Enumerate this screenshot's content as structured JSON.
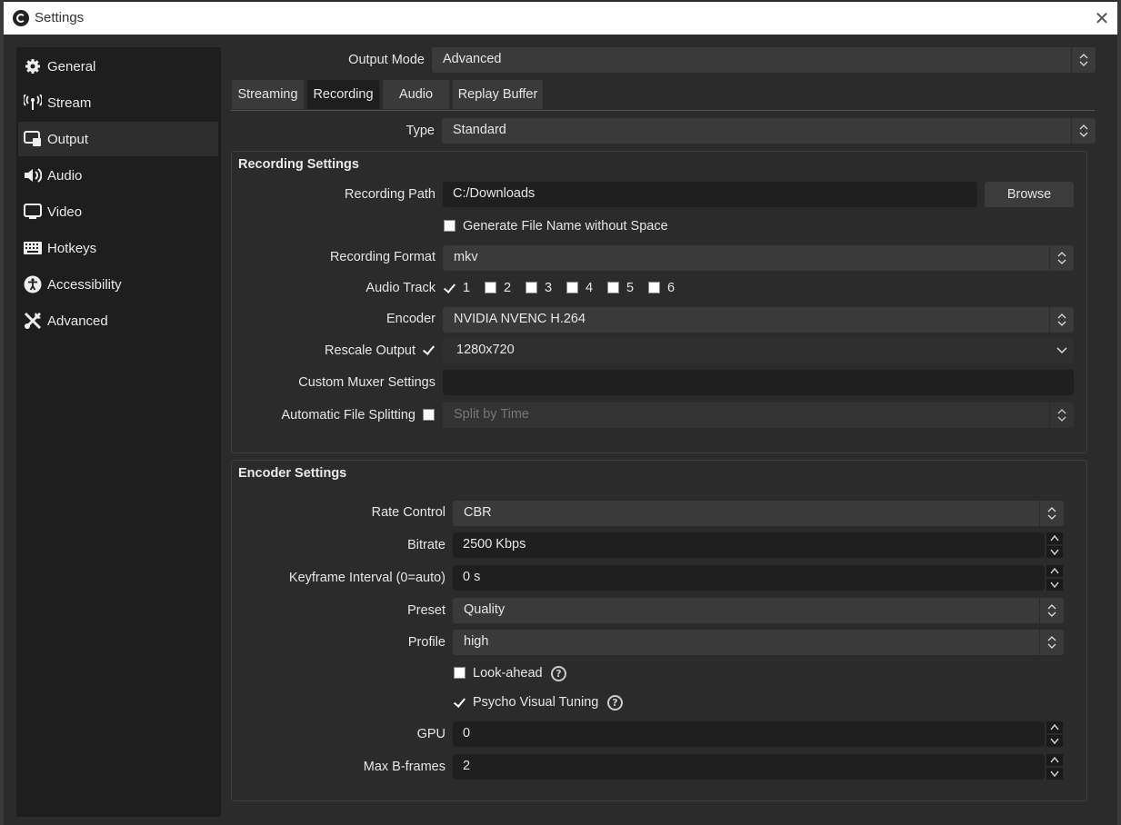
{
  "window": {
    "title": "Settings"
  },
  "sidebar": {
    "items": [
      {
        "label": "General",
        "icon": "gear-icon"
      },
      {
        "label": "Stream",
        "icon": "antenna-icon"
      },
      {
        "label": "Output",
        "icon": "output-icon"
      },
      {
        "label": "Audio",
        "icon": "speaker-icon"
      },
      {
        "label": "Video",
        "icon": "monitor-icon"
      },
      {
        "label": "Hotkeys",
        "icon": "keyboard-icon"
      },
      {
        "label": "Accessibility",
        "icon": "accessibility-icon"
      },
      {
        "label": "Advanced",
        "icon": "tools-icon"
      }
    ],
    "active": "Output"
  },
  "output_mode": {
    "label": "Output Mode",
    "value": "Advanced"
  },
  "tabs": [
    "Streaming",
    "Recording",
    "Audio",
    "Replay Buffer"
  ],
  "active_tab": "Recording",
  "type": {
    "label": "Type",
    "value": "Standard"
  },
  "recording_settings": {
    "title": "Recording Settings",
    "path_label": "Recording Path",
    "path_value": "C:/Downloads",
    "browse_label": "Browse",
    "gen_filename_label": "Generate File Name without Space",
    "format_label": "Recording Format",
    "format_value": "mkv",
    "audio_track_label": "Audio Track",
    "tracks": [
      {
        "label": "1",
        "checked": true
      },
      {
        "label": "2",
        "checked": false
      },
      {
        "label": "3",
        "checked": false
      },
      {
        "label": "4",
        "checked": false
      },
      {
        "label": "5",
        "checked": false
      },
      {
        "label": "6",
        "checked": false
      }
    ],
    "encoder_label": "Encoder",
    "encoder_value": "NVIDIA NVENC H.264",
    "rescale_label": "Rescale Output",
    "rescale_value": "1280x720",
    "muxer_label": "Custom Muxer Settings",
    "muxer_value": "",
    "splitting_label": "Automatic File Splitting",
    "splitting_value": "Split by Time"
  },
  "encoder_settings": {
    "title": "Encoder Settings",
    "rate_control_label": "Rate Control",
    "rate_control_value": "CBR",
    "bitrate_label": "Bitrate",
    "bitrate_value": "2500 Kbps",
    "keyframe_label": "Keyframe Interval (0=auto)",
    "keyframe_value": "0 s",
    "preset_label": "Preset",
    "preset_value": "Quality",
    "profile_label": "Profile",
    "profile_value": "high",
    "lookahead_label": "Look-ahead",
    "psycho_label": "Psycho Visual Tuning",
    "gpu_label": "GPU",
    "gpu_value": "0",
    "bframes_label": "Max B-frames",
    "bframes_value": "2"
  },
  "colors": {
    "background": "#2b2b2b",
    "sidebar": "#1e1e1e",
    "field": "#1f1f1f",
    "combo": "#3a3a3a"
  }
}
